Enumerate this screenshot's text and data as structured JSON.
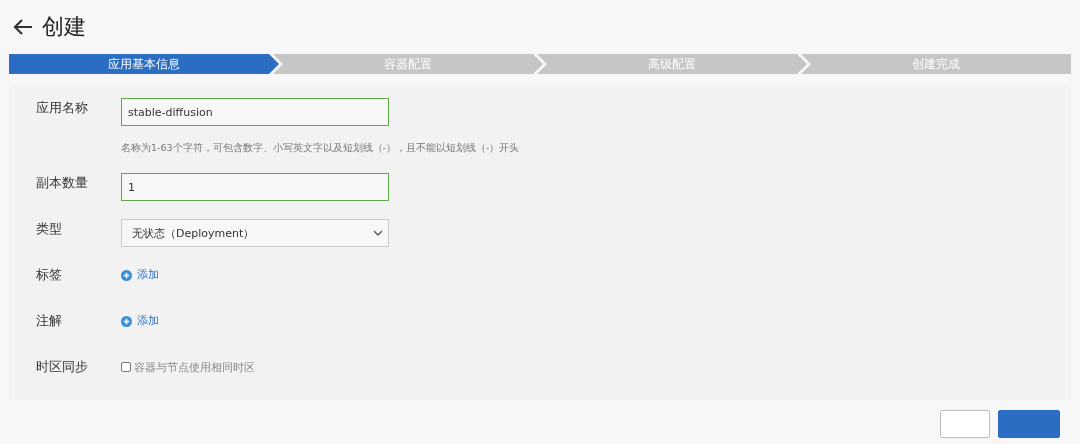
{
  "page": {
    "title": "创建"
  },
  "steps": [
    {
      "label": "应用基本信息",
      "selected": true
    },
    {
      "label": "容器配置",
      "selected": false
    },
    {
      "label": "高级配置",
      "selected": false
    },
    {
      "label": "创建完成",
      "selected": false
    }
  ],
  "form": [
    {
      "kind": "input",
      "label": "应用名称",
      "value": "stable-diffusion",
      "hint": "名称为1-63个字符，可包含数字、小写英文字以及短划线（-），且不能以短划线（-）开头"
    },
    {
      "kind": "input",
      "label": "副本数量",
      "value": "1"
    },
    {
      "kind": "select",
      "label": "类型",
      "value": "无状态（Deployment）"
    },
    {
      "kind": "add",
      "label": "标签",
      "action": "添加"
    },
    {
      "kind": "add",
      "label": "注解",
      "action": "添加"
    },
    {
      "kind": "checkbox",
      "label": "时区同步",
      "option": "容器与节点使用相同时区",
      "checked": false
    }
  ],
  "footer": {
    "buttons": [
      {
        "kind": "secondary"
      },
      {
        "kind": "primary"
      }
    ]
  }
}
